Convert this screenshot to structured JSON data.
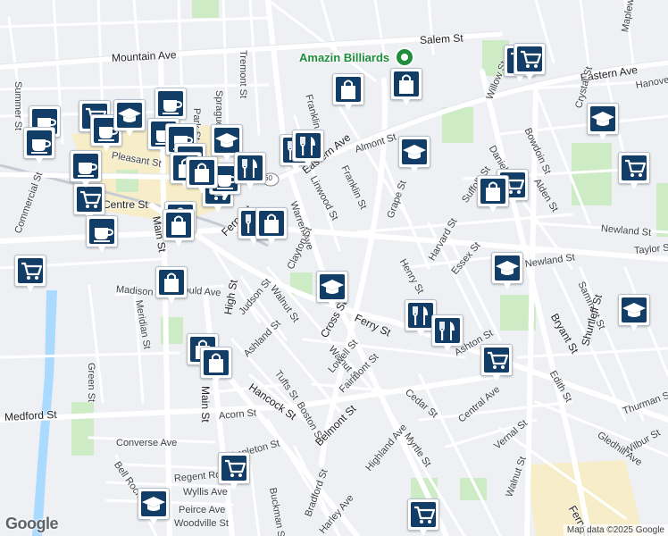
{
  "colors": {
    "land": "#eef0f3",
    "road": "#ffffff",
    "major_road": "#ffffff",
    "park": "#cdebc5",
    "water": "#aadaff",
    "downtown": "#f7edc8",
    "pin": "#123d66"
  },
  "poi": {
    "name": "Amazin Billiards",
    "icon": "shopping-bag-icon"
  },
  "logo": "Google",
  "attribution": "Map data ©2025 Google",
  "streets": [
    {
      "id": "summer-st",
      "name": "Summer St"
    },
    {
      "id": "mountain-ave",
      "name": "Mountain Ave"
    },
    {
      "id": "salem-st",
      "name": "Salem St"
    },
    {
      "id": "eastern-ave-e",
      "name": "Eastern Ave"
    },
    {
      "id": "eastern-ave-w",
      "name": "Eastern Ave"
    },
    {
      "id": "tremont-st",
      "name": "Tremont St"
    },
    {
      "id": "sprague-st",
      "name": "Sprague St"
    },
    {
      "id": "park-st",
      "name": "Park St"
    },
    {
      "id": "franklin-st-n",
      "name": "Franklin St"
    },
    {
      "id": "franklin-st-s",
      "name": "Franklin St"
    },
    {
      "id": "almont-st",
      "name": "Almont St"
    },
    {
      "id": "linwood-st",
      "name": "Linwood St"
    },
    {
      "id": "warren-ave",
      "name": "Warren Ave"
    },
    {
      "id": "grape-st",
      "name": "Grape St"
    },
    {
      "id": "willow-st",
      "name": "Willow St"
    },
    {
      "id": "daniels-st",
      "name": "Daniels St"
    },
    {
      "id": "bowdoin-st",
      "name": "Bowdoin St"
    },
    {
      "id": "alden-st",
      "name": "Alden St"
    },
    {
      "id": "suffolk-st",
      "name": "Suffolk St"
    },
    {
      "id": "newland-st-e",
      "name": "Newland St"
    },
    {
      "id": "newland-st-w",
      "name": "Newland St"
    },
    {
      "id": "taylor-st",
      "name": "Taylor St"
    },
    {
      "id": "harvard-st",
      "name": "Harvard St"
    },
    {
      "id": "henry-st",
      "name": "Henry St"
    },
    {
      "id": "essex-st",
      "name": "Essex St"
    },
    {
      "id": "clayton-st",
      "name": "Clayton St"
    },
    {
      "id": "cross-st",
      "name": "Cross St"
    },
    {
      "id": "ferry-st-mid",
      "name": "Ferry St"
    },
    {
      "id": "ferry-st-w",
      "name": "Ferry St"
    },
    {
      "id": "ferry-st-se",
      "name": "Ferry St"
    },
    {
      "id": "walnut-st-n",
      "name": "Walnut St"
    },
    {
      "id": "walnut-st-m",
      "name": "Walnut St"
    },
    {
      "id": "walnut-st-s",
      "name": "Walnut St"
    },
    {
      "id": "madison-st",
      "name": "Madison St"
    },
    {
      "id": "gould-ave",
      "name": "Gould Ave"
    },
    {
      "id": "meridian-st",
      "name": "Meridian St"
    },
    {
      "id": "high-st",
      "name": "High St"
    },
    {
      "id": "judson-st",
      "name": "Judson St"
    },
    {
      "id": "ashland-st",
      "name": "Ashland St"
    },
    {
      "id": "green-st",
      "name": "Green St"
    },
    {
      "id": "commercial-st",
      "name": "Commercial St"
    },
    {
      "id": "pleasant-st",
      "name": "Pleasant St"
    },
    {
      "id": "centre-st",
      "name": "Centre St"
    },
    {
      "id": "main-st-n",
      "name": "Main St"
    },
    {
      "id": "main-st-s",
      "name": "Main St"
    },
    {
      "id": "medford-st",
      "name": "Medford St"
    },
    {
      "id": "hancock-st",
      "name": "Hancock St"
    },
    {
      "id": "acorn-st",
      "name": "Acorn St"
    },
    {
      "id": "converse-ave",
      "name": "Converse Ave"
    },
    {
      "id": "appleton-st",
      "name": "Appleton St"
    },
    {
      "id": "regent-rd",
      "name": "Regent Rd"
    },
    {
      "id": "wyllis-ave",
      "name": "Wyllis Ave"
    },
    {
      "id": "bell-rock",
      "name": "Bell Rock"
    },
    {
      "id": "peirce-ave",
      "name": "Peirce Ave"
    },
    {
      "id": "woodville-st",
      "name": "Woodville St"
    },
    {
      "id": "tufts-st",
      "name": "Tufts St"
    },
    {
      "id": "boston-st",
      "name": "Boston St"
    },
    {
      "id": "lowell-st",
      "name": "Lowell St"
    },
    {
      "id": "fairmont-st",
      "name": "Fairmont St"
    },
    {
      "id": "belmont-st",
      "name": "Belmont St"
    },
    {
      "id": "cedar-st",
      "name": "Cedar St"
    },
    {
      "id": "central-ave",
      "name": "Central Ave"
    },
    {
      "id": "vernal-st",
      "name": "Vernal St"
    },
    {
      "id": "myrtle-st",
      "name": "Myrtle St"
    },
    {
      "id": "highland-ave",
      "name": "Highland Ave"
    },
    {
      "id": "buckman-st",
      "name": "Buckman St"
    },
    {
      "id": "bradford-st",
      "name": "Bradford St"
    },
    {
      "id": "harley-ave",
      "name": "Harley Ave"
    },
    {
      "id": "ashton-st",
      "name": "Ashton St"
    },
    {
      "id": "bryant-st",
      "name": "Bryant St"
    },
    {
      "id": "sammett-st",
      "name": "Sammett St"
    },
    {
      "id": "edith-st",
      "name": "Edith St"
    },
    {
      "id": "shurtleff-st",
      "name": "Shurtleff St"
    },
    {
      "id": "thurman-st",
      "name": "Thurman St"
    },
    {
      "id": "wilbur-st",
      "name": "Wilbur St"
    },
    {
      "id": "gledhill-ave",
      "name": "Gledhill Ave"
    },
    {
      "id": "maplewood-st",
      "name": "Maplewood St"
    },
    {
      "id": "crystal-st",
      "name": "Crystal St"
    },
    {
      "id": "hanover-st",
      "name": "Hanover St"
    },
    {
      "id": "walnut-st-se",
      "name": "Walnut St"
    },
    {
      "id": "ferry-st-s",
      "name": "Ferry St"
    },
    {
      "id": "route-60",
      "name": "60"
    }
  ],
  "markers": [
    {
      "type": "grocery",
      "icon": "shopping-cart-icon"
    },
    {
      "type": "grocery",
      "icon": "shopping-cart-icon"
    },
    {
      "type": "grocery",
      "icon": "shopping-cart-icon"
    },
    {
      "type": "grocery",
      "icon": "shopping-cart-icon"
    },
    {
      "type": "grocery",
      "icon": "shopping-cart-icon"
    },
    {
      "type": "grocery",
      "icon": "shopping-cart-icon"
    },
    {
      "type": "grocery",
      "icon": "shopping-cart-icon"
    },
    {
      "type": "grocery",
      "icon": "shopping-cart-icon"
    },
    {
      "type": "grocery",
      "icon": "shopping-cart-icon"
    },
    {
      "type": "grocery",
      "icon": "shopping-cart-icon"
    },
    {
      "type": "grocery",
      "icon": "shopping-cart-icon"
    },
    {
      "type": "cafe",
      "icon": "coffee-cup-icon"
    },
    {
      "type": "cafe",
      "icon": "coffee-cup-icon"
    },
    {
      "type": "cafe",
      "icon": "coffee-cup-icon"
    },
    {
      "type": "cafe",
      "icon": "coffee-cup-icon"
    },
    {
      "type": "cafe",
      "icon": "coffee-cup-icon"
    },
    {
      "type": "cafe",
      "icon": "coffee-cup-icon"
    },
    {
      "type": "cafe",
      "icon": "coffee-cup-icon"
    },
    {
      "type": "cafe",
      "icon": "coffee-cup-icon"
    },
    {
      "type": "cafe",
      "icon": "coffee-cup-icon"
    },
    {
      "type": "cafe",
      "icon": "coffee-cup-icon"
    },
    {
      "type": "school",
      "icon": "graduation-cap-icon"
    },
    {
      "type": "school",
      "icon": "graduation-cap-icon"
    },
    {
      "type": "school",
      "icon": "graduation-cap-icon"
    },
    {
      "type": "school",
      "icon": "graduation-cap-icon"
    },
    {
      "type": "school",
      "icon": "graduation-cap-icon"
    },
    {
      "type": "school",
      "icon": "graduation-cap-icon"
    },
    {
      "type": "school",
      "icon": "graduation-cap-icon"
    },
    {
      "type": "school",
      "icon": "graduation-cap-icon"
    },
    {
      "type": "restaurant",
      "icon": "fork-knife-icon"
    },
    {
      "type": "restaurant",
      "icon": "fork-knife-icon"
    },
    {
      "type": "restaurant",
      "icon": "fork-knife-icon"
    },
    {
      "type": "restaurant",
      "icon": "fork-knife-icon"
    },
    {
      "type": "restaurant",
      "icon": "fork-knife-icon"
    },
    {
      "type": "restaurant",
      "icon": "fork-knife-icon"
    },
    {
      "type": "shop",
      "icon": "shopping-bag-icon"
    },
    {
      "type": "shop",
      "icon": "shopping-bag-icon"
    },
    {
      "type": "shop",
      "icon": "shopping-bag-icon"
    },
    {
      "type": "shop",
      "icon": "shopping-bag-icon"
    },
    {
      "type": "shop",
      "icon": "shopping-bag-icon"
    },
    {
      "type": "shop",
      "icon": "shopping-bag-icon"
    },
    {
      "type": "shop",
      "icon": "shopping-bag-icon"
    },
    {
      "type": "shop",
      "icon": "shopping-bag-icon"
    },
    {
      "type": "shop",
      "icon": "shopping-bag-icon"
    },
    {
      "type": "shop",
      "icon": "shopping-bag-icon"
    },
    {
      "type": "shop",
      "icon": "shopping-bag-icon"
    }
  ]
}
